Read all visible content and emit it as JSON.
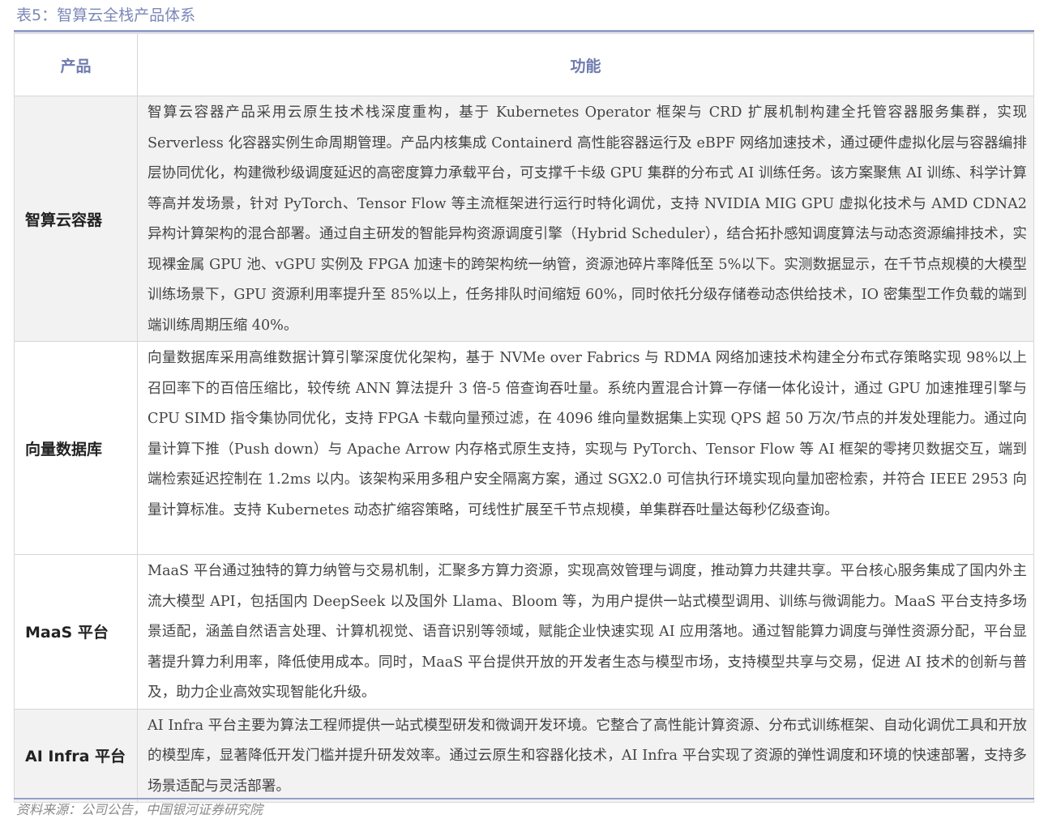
{
  "caption": "表5：智算云全栈产品体系",
  "table": {
    "headers": [
      "产品",
      "功能"
    ],
    "rows": [
      {
        "product": "智算云容器",
        "description": "智算云容器产品采用云原生技术栈深度重构，基于 Kubernetes Operator 框架与 CRD 扩展机制构建全托管容器服务集群，实现 Serverless 化容器实例生命周期管理。产品内核集成 Containerd 高性能容器运行及 eBPF 网络加速技术，通过硬件虚拟化层与容器编排层协同优化，构建微秒级调度延迟的高密度算力承载平台，可支撑千卡级 GPU 集群的分布式 AI 训练任务。该方案聚焦 AI 训练、科学计算等高并发场景，针对 PyTorch、Tensor Flow 等主流框架进行运行时特化调优，支持 NVIDIA MIG GPU 虚拟化技术与 AMD CDNA2 异构计算架构的混合部署。通过自主研发的智能异构资源调度引擎（Hybrid Scheduler），结合拓扑感知调度算法与动态资源编排技术，实现裸金属 GPU 池、vGPU 实例及 FPGA 加速卡的跨架构统一纳管，资源池碎片率降低至 5%以下。实测数据显示，在千节点规模的大模型训练场景下，GPU 资源利用率提升至 85%以上，任务排队时间缩短 60%，同时依托分级存储卷动态供给技术，IO 密集型工作负载的端到端训练周期压缩 40%。"
      },
      {
        "product": "向量数据库",
        "description": "向量数据库采用高维数据计算引擎深度优化架构，基于 NVMe over Fabrics 与 RDMA 网络加速技术构建全分布式存策略实现 98%以上召回率下的百倍压缩比，较传统 ANN 算法提升 3 倍-5 倍查询吞吐量。系统内置混合计算一存储一体化设计，通过 GPU 加速推理引擎与 CPU SIMD 指令集协同优化，支持 FPGA 卡载向量预过滤，在 4096 维向量数据集上实现 QPS 超 50 万次/节点的并发处理能力。通过向量计算下推（Push down）与 Apache Arrow 内存格式原生支持，实现与 PyTorch、Tensor Flow 等 AI 框架的零拷贝数据交互，端到端检索延迟控制在 1.2ms 以内。该架构采用多租户安全隔离方案，通过 SGX2.0 可信执行环境实现向量加密检索，并符合 IEEE 2953 向量计算标准。支持 Kubernetes 动态扩缩容策略，可线性扩展至千节点规模，单集群吞吐量达每秒亿级查询。"
      },
      {
        "product": "MaaS 平台",
        "description": "MaaS 平台通过独特的算力纳管与交易机制，汇聚多方算力资源，实现高效管理与调度，推动算力共建共享。平台核心服务集成了国内外主流大模型 API，包括国内 DeepSeek 以及国外 Llama、Bloom 等，为用户提供一站式模型调用、训练与微调能力。MaaS 平台支持多场景适配，涵盖自然语言处理、计算机视觉、语音识别等领域，赋能企业快速实现 AI 应用落地。通过智能算力调度与弹性资源分配，平台显著提升算力利用率，降低使用成本。同时，MaaS 平台提供开放的开发者生态与模型市场，支持模型共享与交易，促进 AI 技术的创新与普及，助力企业高效实现智能化升级。"
      },
      {
        "product": "AI Infra 平台",
        "description": "AI Infra 平台主要为算法工程师提供一站式模型研发和微调开发环境。它整合了高性能计算资源、分布式训练框架、自动化调优工具和开放的模型库，显著降低开发门槛并提升研发效率。通过云原生和容器化技术，AI Infra 平台实现了资源的弹性调度和环境的快速部署，支持多场景适配与灵活部署。"
      }
    ]
  },
  "source": "资料来源：公司公告，中国银河证券研究院"
}
